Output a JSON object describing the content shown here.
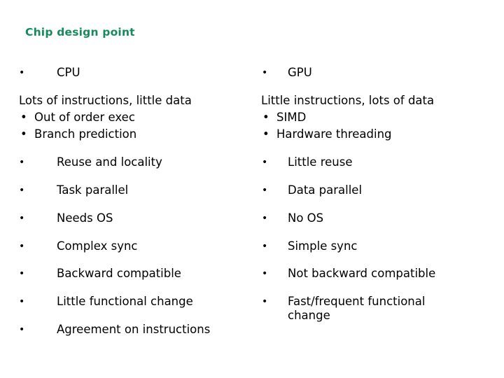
{
  "title": "Chip design point",
  "bullet_glyph": "•",
  "cpu": {
    "heading": "CPU",
    "summary": "Lots of instructions, little data",
    "sub_items": [
      "Out of order exec",
      "Branch prediction"
    ],
    "items": [
      "Reuse and locality",
      "Task parallel",
      "Needs OS",
      "Complex sync",
      "Backward compatible",
      "Little functional change",
      "Agreement on instructions"
    ]
  },
  "gpu": {
    "heading": "GPU",
    "summary": "Little instructions, lots of data",
    "sub_items": [
      "SIMD",
      "Hardware threading"
    ],
    "items": [
      "Little reuse",
      "Data parallel",
      "No OS",
      "Simple sync",
      "Not backward compatible",
      "Fast/frequent functional change"
    ]
  }
}
